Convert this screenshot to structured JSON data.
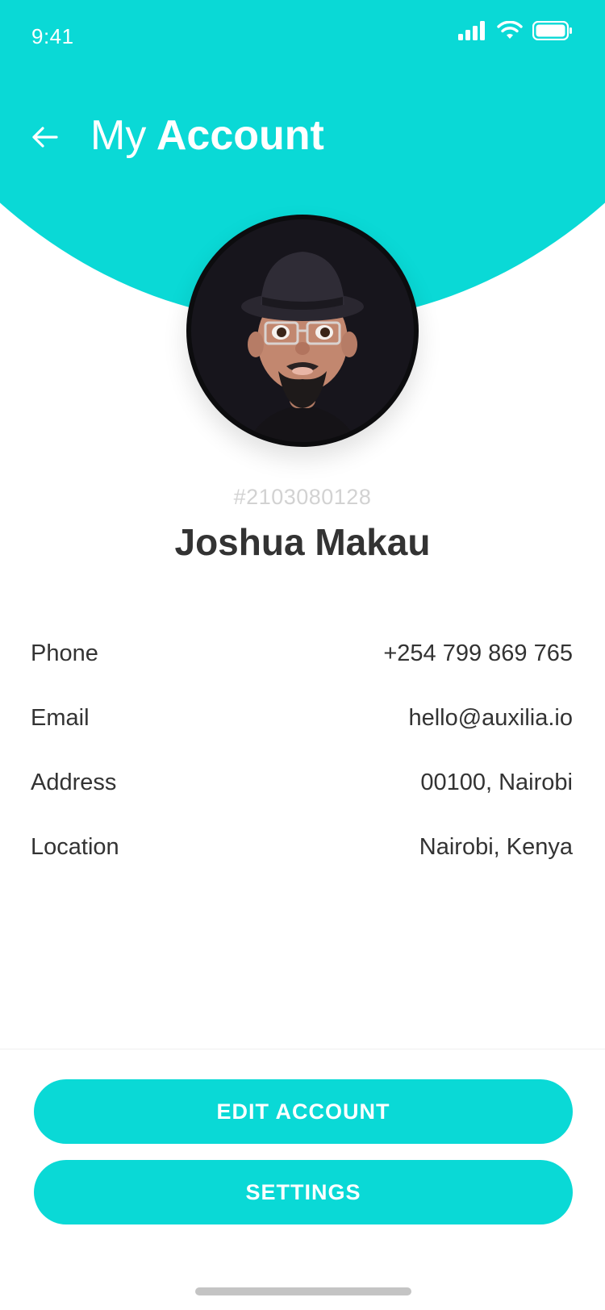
{
  "status_bar": {
    "time": "9:41",
    "icons": [
      "signal-icon",
      "wifi-icon",
      "battery-icon"
    ]
  },
  "header": {
    "back_icon": "arrow-left-icon",
    "title_light": "My",
    "title_bold": "Account"
  },
  "profile": {
    "avatar": "memoji-avatar",
    "id": "#2103080128",
    "name": "Joshua Makau"
  },
  "details": [
    {
      "label": "Phone",
      "value": "+254 799 869 765"
    },
    {
      "label": "Email",
      "value": "hello@auxilia.io"
    },
    {
      "label": "Address",
      "value": "00100, Nairobi"
    },
    {
      "label": "Location",
      "value": "Nairobi, Kenya"
    }
  ],
  "actions": {
    "edit_label": "EDIT ACCOUNT",
    "settings_label": "SETTINGS"
  },
  "colors": {
    "accent": "#0ad9d6",
    "text": "#333333",
    "muted": "#d2d2d2"
  }
}
